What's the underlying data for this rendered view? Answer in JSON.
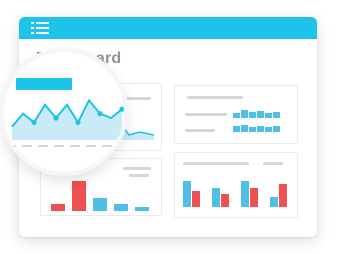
{
  "header": {
    "menu_icon": "hamburger-menu-icon",
    "title": "Dashboard"
  },
  "colors": {
    "accent": "#1ec3ea",
    "bar_blue": "#4ec0e6",
    "bar_red": "#ef5050",
    "line_fill": "#c9ebf7"
  },
  "widgets": {
    "line_chart": {
      "values": [
        3,
        6,
        4,
        8,
        5,
        8,
        4,
        9,
        6,
        5,
        7
      ]
    },
    "small_bar_chart": {
      "values": [
        4,
        16,
        7,
        4,
        2
      ]
    },
    "grouped_bar_chart": {
      "series": [
        {
          "values": [
            8,
            6,
            8,
            3
          ]
        },
        {
          "values": [
            5,
            4,
            6,
            7
          ]
        }
      ]
    },
    "mini_bars": {
      "values": [
        1,
        2,
        1,
        1.5,
        2,
        1,
        1,
        1.5,
        1,
        2,
        1
      ]
    }
  }
}
